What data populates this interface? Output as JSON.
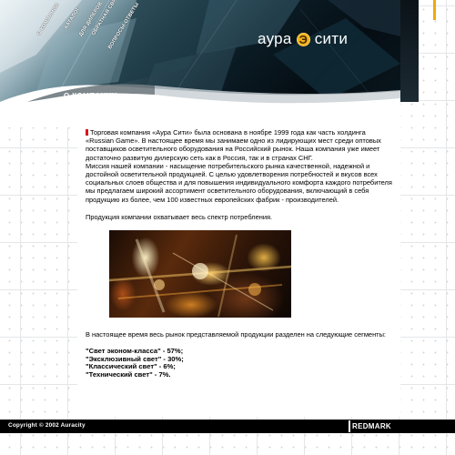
{
  "nav": {
    "items": [
      "О КОМПАНИИ",
      "КАТАЛОГ",
      "ДЛЯ ДИЛЕРОВ",
      "ОБРАТНАЯ СВЯЗЬ",
      "ВОПРОСЫ-ОТВЕТЫ"
    ]
  },
  "logo": {
    "word1": "аура",
    "letter": "Э",
    "word2": "сити"
  },
  "section_title": "О КОМПАНИИ",
  "content": {
    "para1": "Торговая компания «Аура Сити» была основана в ноябре 1999 года как часть холдинга «Russian Game». В настоящее время мы занимаем одно из лидирующих мест среди оптовых поставщиков осветительного оборудования на Российский рынок. Наша компания уже имеет достаточно развитую дилерскую сеть как в Россия, так и в странах СНГ.",
    "para2": "Миссия нашей компании - насыщение потребительского рынка качественной, надежной и достойной осветительной продукцией. С целью удовлетворения потребностей и вкусов всех социальных слоев общества и для повышения индивидуального комфорта каждого потребителя мы предлагаем широкий ассортимент осветительного оборудования, включающий в себя продукцию из более, чем 100 известных европейских фабрик - производителей.",
    "para3": "Продукция компании охватывает весь спектр потребления.",
    "para4": "В настоящее время весь рынок представляемой продукции разделен на следующие сегменты:",
    "segments": [
      "\"Свет эконом-класса\" - 57%;",
      "\"Эксклюзивный свет\" - 30%;",
      "\"Классический свет\" - 6%;",
      "\"Технический свет\" - 7%."
    ]
  },
  "footer": {
    "copyright": "Copyright © 2002 Auracity",
    "credit": "REDMARK"
  },
  "colors": {
    "accent_orange": "#f2a900",
    "bullet_red": "#d7141a",
    "header_dark": "#050d13",
    "footer_bg": "#000000"
  }
}
